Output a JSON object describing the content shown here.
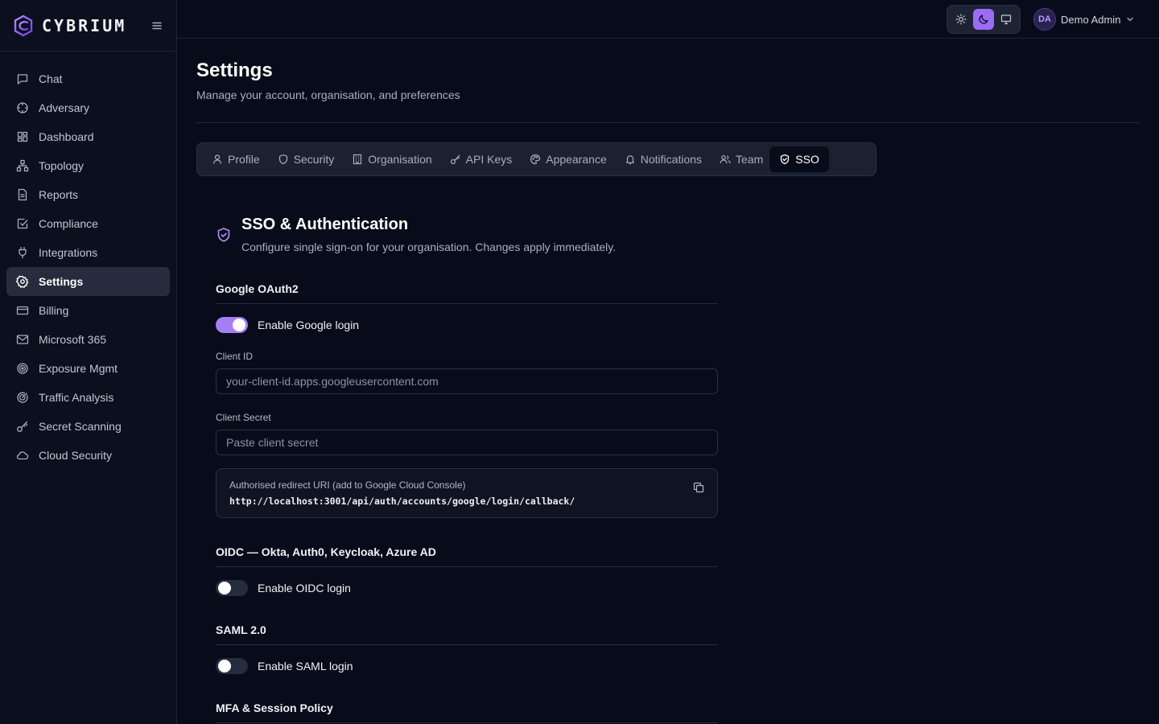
{
  "brand": {
    "name": "CYBRIUM",
    "accent": "#9b6cf5"
  },
  "sidebar": {
    "items": [
      {
        "label": "Chat",
        "icon": "message-square-icon"
      },
      {
        "label": "Adversary",
        "icon": "crosshair-icon"
      },
      {
        "label": "Dashboard",
        "icon": "layout-dashboard-icon"
      },
      {
        "label": "Topology",
        "icon": "network-icon"
      },
      {
        "label": "Reports",
        "icon": "file-text-icon"
      },
      {
        "label": "Compliance",
        "icon": "check-square-icon"
      },
      {
        "label": "Integrations",
        "icon": "plug-icon"
      },
      {
        "label": "Settings",
        "icon": "settings-icon",
        "active": true
      },
      {
        "label": "Billing",
        "icon": "credit-card-icon"
      },
      {
        "label": "Microsoft 365",
        "icon": "mail-icon"
      },
      {
        "label": "Exposure Mgmt",
        "icon": "target-icon"
      },
      {
        "label": "Traffic Analysis",
        "icon": "radar-icon"
      },
      {
        "label": "Secret Scanning",
        "icon": "key-icon"
      },
      {
        "label": "Cloud Security",
        "icon": "cloud-icon"
      }
    ]
  },
  "topbar": {
    "theme": {
      "options": [
        "sun-icon",
        "moon-icon",
        "monitor-icon"
      ],
      "selected": "moon-icon"
    },
    "user": {
      "initials": "DA",
      "name": "Demo Admin"
    }
  },
  "page": {
    "title": "Settings",
    "subtitle": "Manage your account, organisation, and preferences"
  },
  "tabs": [
    {
      "label": "Profile",
      "icon": "user-icon"
    },
    {
      "label": "Security",
      "icon": "shield-icon"
    },
    {
      "label": "Organisation",
      "icon": "building-icon"
    },
    {
      "label": "API Keys",
      "icon": "key-icon"
    },
    {
      "label": "Appearance",
      "icon": "palette-icon"
    },
    {
      "label": "Notifications",
      "icon": "bell-icon"
    },
    {
      "label": "Team",
      "icon": "users-icon"
    },
    {
      "label": "SSO",
      "icon": "shield-check-icon",
      "active": true
    }
  ],
  "sso": {
    "title": "SSO & Authentication",
    "subtitle": "Configure single sign-on for your organisation. Changes apply immediately.",
    "google": {
      "heading": "Google OAuth2",
      "toggle_label": "Enable Google login",
      "enabled": true,
      "client_id_label": "Client ID",
      "client_id_placeholder": "your-client-id.apps.googleusercontent.com",
      "client_id_value": "",
      "client_secret_label": "Client Secret",
      "client_secret_placeholder": "Paste client secret",
      "client_secret_value": "",
      "redirect_label": "Authorised redirect URI (add to Google Cloud Console)",
      "redirect_uri": "http://localhost:3001/api/auth/accounts/google/login/callback/"
    },
    "oidc": {
      "heading": "OIDC — Okta, Auth0, Keycloak, Azure AD",
      "toggle_label": "Enable OIDC login",
      "enabled": false
    },
    "saml": {
      "heading": "SAML 2.0",
      "toggle_label": "Enable SAML login",
      "enabled": false
    },
    "mfa": {
      "heading": "MFA & Session Policy"
    }
  }
}
